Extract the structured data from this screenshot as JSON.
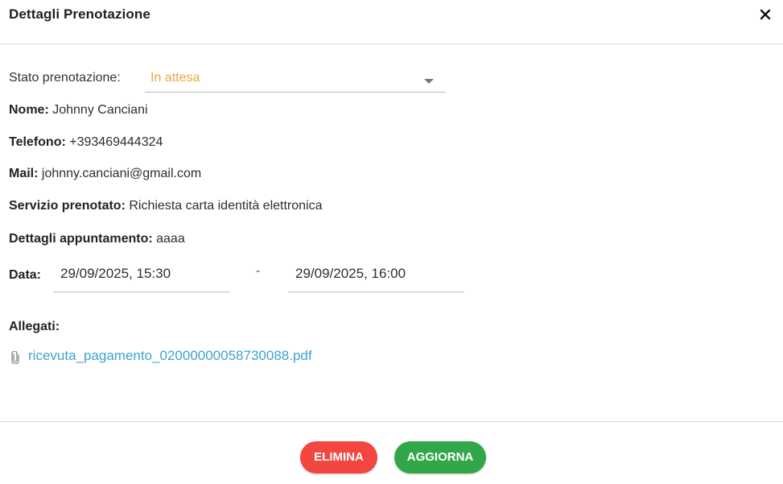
{
  "modal": {
    "title": "Dettagli Prenotazione",
    "close_icon": "close-icon"
  },
  "status": {
    "label": "Stato prenotazione:",
    "value": "In attesa",
    "value_color": "#f0a43a"
  },
  "fields": {
    "name_label": "Nome:",
    "name_value": "Johnny Canciani",
    "phone_label": "Telefono:",
    "phone_value": "+393469444324",
    "mail_label": "Mail:",
    "mail_value": "johnny.canciani@gmail.com",
    "service_label": "Servizio prenotato:",
    "service_value": "Richiesta carta identità elettronica",
    "details_label": "Dettagli appuntamento:",
    "details_value": "aaaa",
    "date_label": "Data:",
    "date_start": "29/09/2025, 15:30",
    "date_separator": "-",
    "date_end": "29/09/2025, 16:00"
  },
  "attachments": {
    "label": "Allegati:",
    "items": [
      {
        "icon": "paperclip-icon",
        "filename": "ricevuta_pagamento_02000000058730088.pdf"
      }
    ],
    "link_color": "#3ea3cf"
  },
  "actions": {
    "delete_label": "ELIMINA",
    "delete_color": "#f2463f",
    "update_label": "AGGIORNA",
    "update_color": "#32a74a"
  }
}
